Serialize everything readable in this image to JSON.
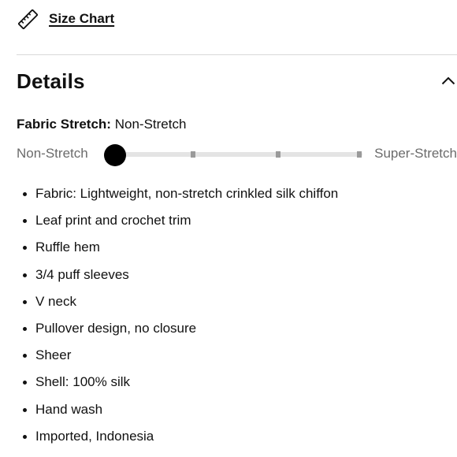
{
  "size_chart": {
    "label": "Size Chart",
    "icon": "ruler-icon"
  },
  "details": {
    "title": "Details",
    "expanded": true,
    "toggle_icon": "chevron-up-icon"
  },
  "fabric_stretch": {
    "key": "Fabric Stretch:",
    "value": "Non-Stretch",
    "scale_min_label": "Non-Stretch",
    "scale_max_label": "Super-Stretch",
    "level": 0,
    "steps": 4
  },
  "features": [
    "Fabric: Lightweight, non-stretch crinkled silk chiffon",
    "Leaf print and crochet trim",
    "Ruffle hem",
    "3/4 puff sleeves",
    "V neck",
    "Pullover design, no closure",
    "Sheer",
    "Shell: 100% silk",
    "Hand wash",
    "Imported, Indonesia"
  ]
}
